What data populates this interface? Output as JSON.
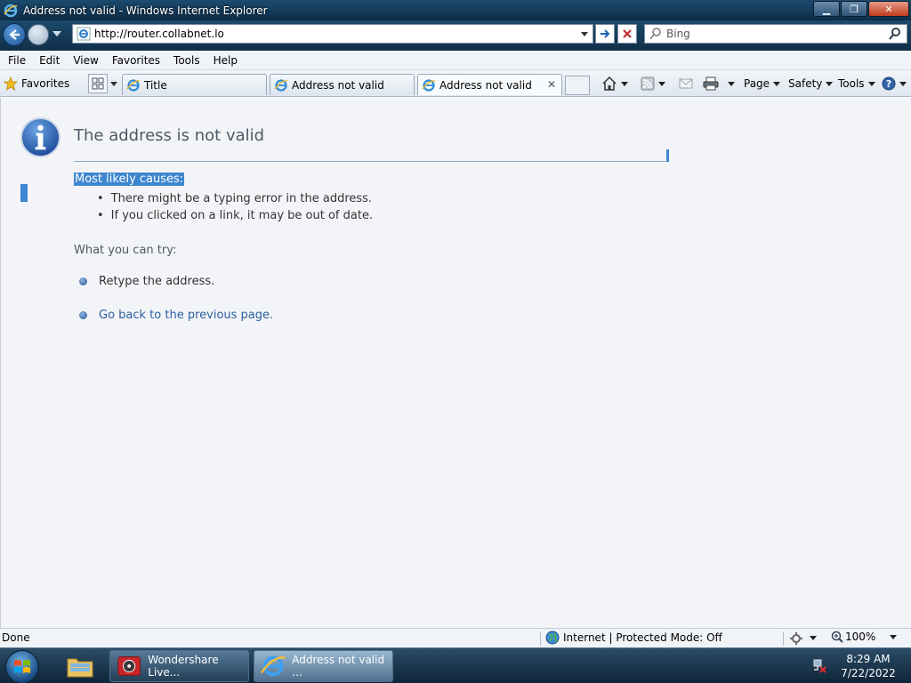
{
  "window": {
    "title": "Address not valid - Windows Internet Explorer",
    "minimize_glyph": "▁",
    "maximize_glyph": "❐",
    "close_glyph": "✕"
  },
  "nav": {
    "url": "http://router.collabnet.lo",
    "search_placeholder": "Bing"
  },
  "menu": [
    "File",
    "Edit",
    "View",
    "Favorites",
    "Tools",
    "Help"
  ],
  "favorites_label": "Favorites",
  "tabs": [
    {
      "label": "Title"
    },
    {
      "label": "Address not valid"
    },
    {
      "label": "Address not valid",
      "active": true,
      "close": "✕"
    }
  ],
  "commands": {
    "page": "Page",
    "safety": "Safety",
    "tools": "Tools"
  },
  "content": {
    "heading": "The address is not valid",
    "causes_title": "Most likely causes:",
    "causes": [
      "There might be a typing error in the address.",
      "If you clicked on a link, it may be out of date."
    ],
    "try_title": "What you can try:",
    "try_items": [
      {
        "text": "Retype the address.",
        "link": false
      },
      {
        "text": "Go back to the previous page.",
        "link": true
      }
    ]
  },
  "status": {
    "text": "Done",
    "zone": "Internet | Protected Mode: Off",
    "zoom": "100%"
  },
  "taskbar": {
    "apps": [
      {
        "label": "Wondershare Live..."
      },
      {
        "label": "Address not valid ...",
        "active": true
      }
    ],
    "time": "8:29 AM",
    "date": "7/22/2022"
  },
  "colors": {
    "accent": "#3e86cf",
    "link": "#2a5fa0",
    "heading": "#4d5a66"
  }
}
